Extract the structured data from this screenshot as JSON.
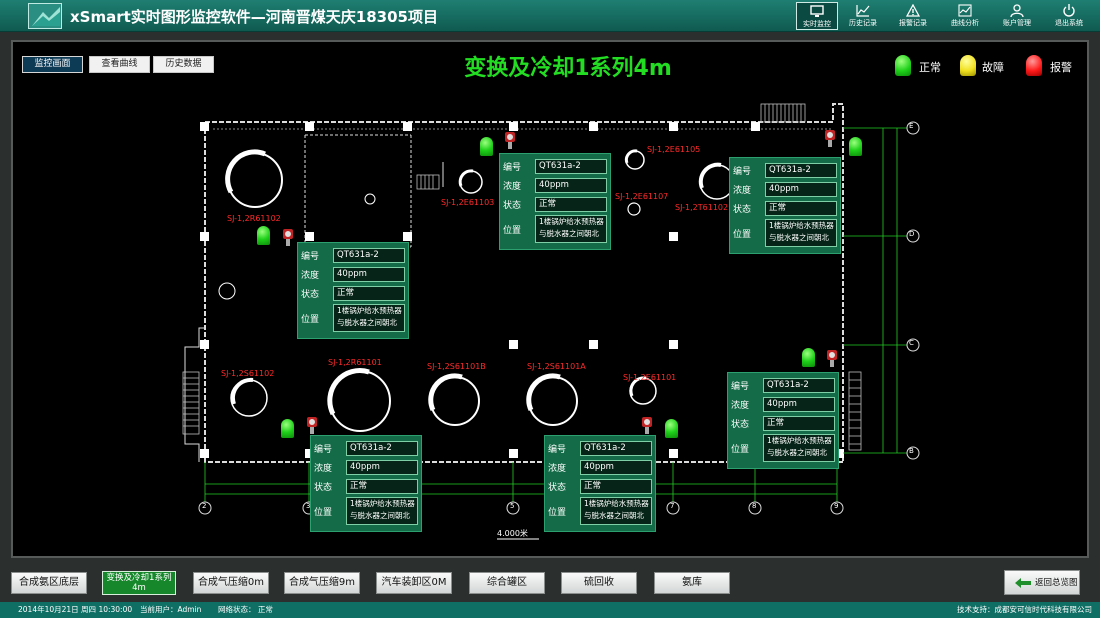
{
  "header": {
    "title": "xSmart实时图形监控软件—河南晋煤天庆18305项目",
    "nav": [
      {
        "label": "实时监控",
        "icon": "monitor-icon",
        "active": true
      },
      {
        "label": "历史记录",
        "icon": "line-chart-icon",
        "active": false
      },
      {
        "label": "报警记录",
        "icon": "warning-icon",
        "active": false
      },
      {
        "label": "曲线分析",
        "icon": "curve-analysis-icon",
        "active": false
      },
      {
        "label": "账户管理",
        "icon": "user-icon",
        "active": false
      },
      {
        "label": "退出系统",
        "icon": "power-icon",
        "active": false
      }
    ]
  },
  "tabs": [
    {
      "label": "监控画面",
      "active": true
    },
    {
      "label": "查看曲线",
      "active": false
    },
    {
      "label": "历史数据",
      "active": false
    }
  ],
  "page_title": "变换及冷却1系列4m",
  "legend": [
    {
      "label": "正常",
      "color": "#1fd11a"
    },
    {
      "label": "故障",
      "color": "#f0e020"
    },
    {
      "label": "报警",
      "color": "#ff1a1a"
    }
  ],
  "axis_labels": {
    "rows": [
      "E",
      "D",
      "C",
      "B"
    ],
    "cols": [
      "2",
      "3",
      "5",
      "7",
      "8",
      "9"
    ]
  },
  "scale_label": "4.000米",
  "sensor_labels": [
    "SJ-1,2R61102",
    "SJ-1,2E61103",
    "SJ-1,2E61105",
    "SJ-1,2E61107",
    "SJ-1,2T61102",
    "SJ-1,2S61102",
    "SJ-1,2R61101",
    "SJ-1,2S61101B",
    "SJ-1,2S61101A",
    "SJ-1,2E61101"
  ],
  "card_fields": {
    "id": "编号",
    "conc": "浓度",
    "status": "状态",
    "pos": "位置"
  },
  "cards": [
    {
      "id": "QT631a-2",
      "conc": "40ppm",
      "status": "正常",
      "pos": "1楼锅炉给水预热器与脱水器之间朝北"
    },
    {
      "id": "QT631a-2",
      "conc": "40ppm",
      "status": "正常",
      "pos": "1楼锅炉给水预热器与脱水器之间朝北"
    },
    {
      "id": "QT631a-2",
      "conc": "40ppm",
      "status": "正常",
      "pos": "1楼锅炉给水预热器与脱水器之间朝北"
    },
    {
      "id": "QT631a-2",
      "conc": "40ppm",
      "status": "正常",
      "pos": "1楼锅炉给水预热器与脱水器之间朝北"
    },
    {
      "id": "QT631a-2",
      "conc": "40ppm",
      "status": "正常",
      "pos": "1楼锅炉给水预热器与脱水器之间朝北"
    },
    {
      "id": "QT631a-2",
      "conc": "40ppm",
      "status": "正常",
      "pos": "1楼锅炉给水预热器与脱水器之间朝北"
    }
  ],
  "bottom_nav": [
    {
      "label": "合成氨区底层",
      "active": false
    },
    {
      "label": "变换及冷却1系列4m",
      "active": true
    },
    {
      "label": "合成气压缩0m",
      "active": false
    },
    {
      "label": "合成气压缩9m",
      "active": false
    },
    {
      "label": "汽车装卸区0M",
      "active": false
    },
    {
      "label": "综合罐区",
      "active": false
    },
    {
      "label": "硫回收",
      "active": false
    },
    {
      "label": "氨库",
      "active": false
    }
  ],
  "back_button": {
    "label": "返回总览图",
    "icon": "arrow-left-icon"
  },
  "status_bar": {
    "datetime": "2014年10月21日 周四 10:30:00",
    "user": "当前用户：Admin",
    "network": "网络状态： 正常",
    "support": "技术支持：成都安可信时代科技有限公司"
  }
}
